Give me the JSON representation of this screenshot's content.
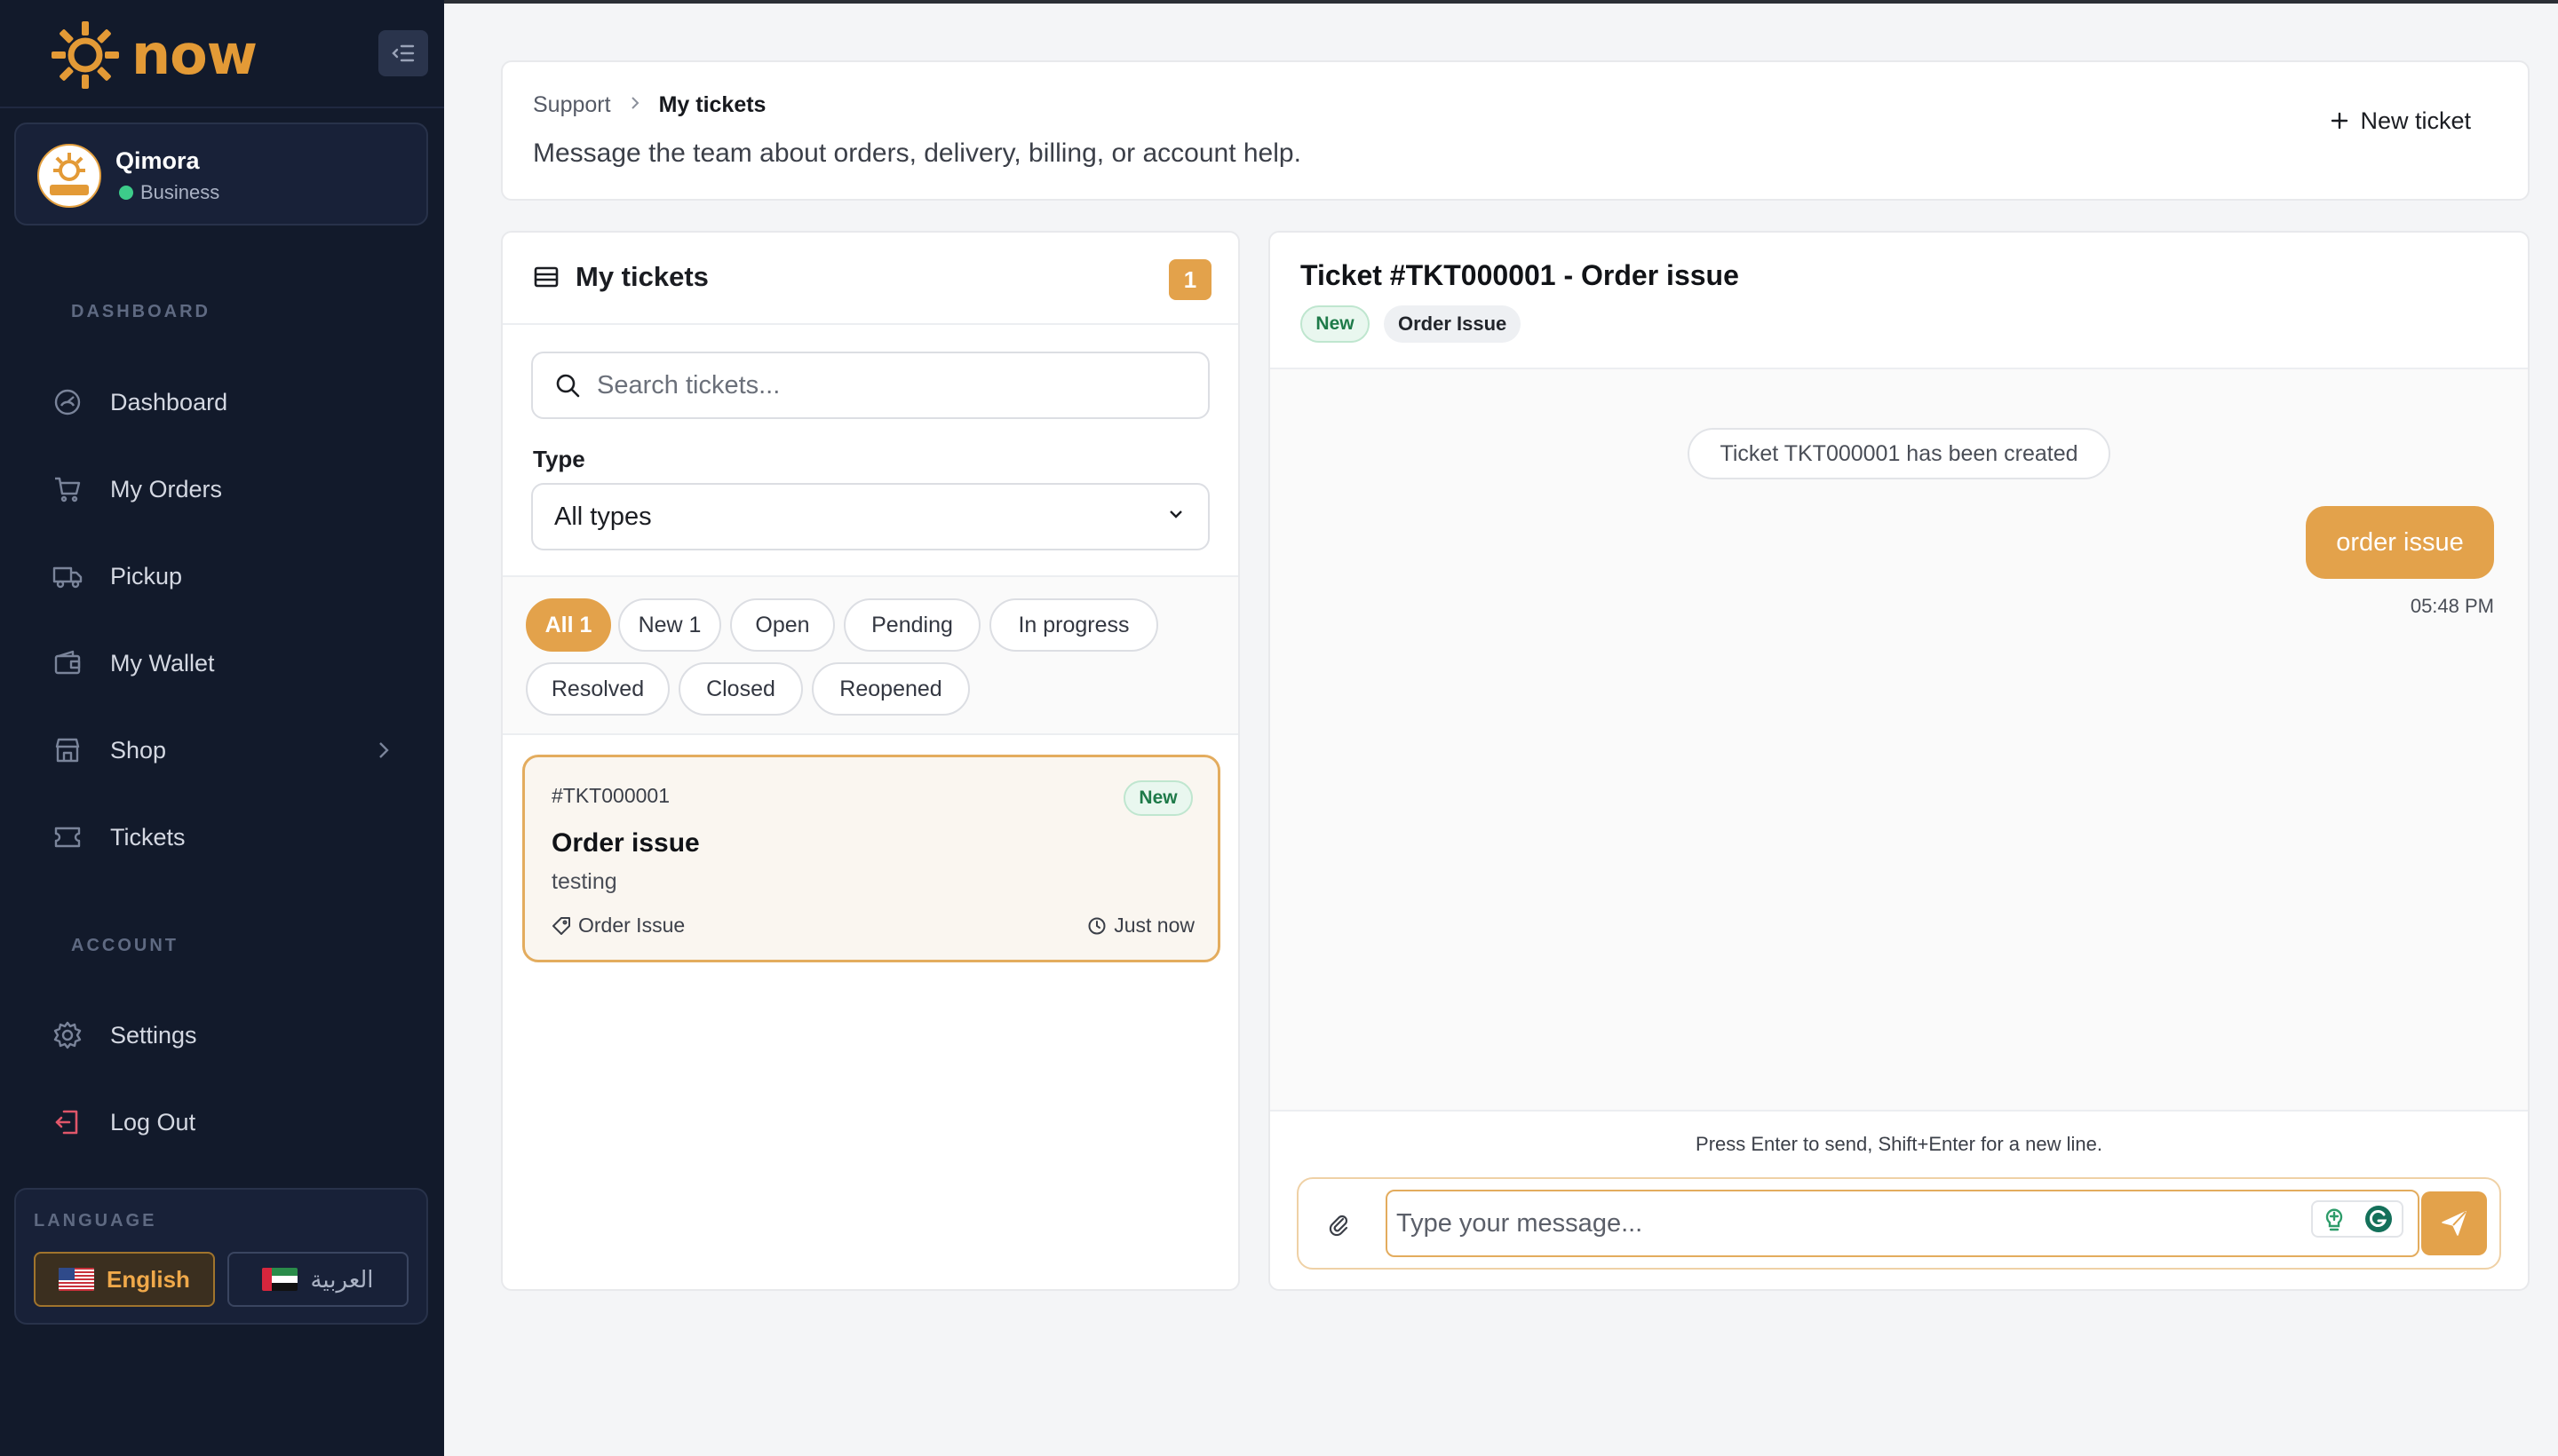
{
  "brand": {
    "name": "now",
    "accent": "#e3a24b"
  },
  "profile": {
    "name": "Qimora",
    "role": "Business"
  },
  "sidebar": {
    "section_dashboard": "DASHBOARD",
    "section_account": "ACCOUNT",
    "items": [
      {
        "label": "Dashboard",
        "icon": "gauge-icon"
      },
      {
        "label": "My Orders",
        "icon": "cart-icon"
      },
      {
        "label": "Pickup",
        "icon": "truck-icon"
      },
      {
        "label": "My Wallet",
        "icon": "wallet-icon"
      },
      {
        "label": "Shop",
        "icon": "store-icon"
      },
      {
        "label": "Tickets",
        "icon": "ticket-icon"
      }
    ],
    "account_items": [
      {
        "label": "Settings",
        "icon": "gear-icon"
      },
      {
        "label": "Log Out",
        "icon": "logout-icon"
      }
    ]
  },
  "language": {
    "label": "LANGUAGE",
    "english": "English",
    "arabic": "العربية"
  },
  "header": {
    "breadcrumb_root": "Support",
    "breadcrumb_current": "My tickets",
    "subtitle": "Message the team about orders, delivery, billing, or account help.",
    "new_ticket": "New ticket"
  },
  "tickets_panel": {
    "title": "My tickets",
    "count": "1",
    "search_placeholder": "Search tickets...",
    "type_label": "Type",
    "type_selected": "All types",
    "filters": [
      "All 1",
      "New 1",
      "Open",
      "Pending",
      "In progress",
      "Resolved",
      "Closed",
      "Reopened"
    ],
    "items": [
      {
        "id": "#TKT000001",
        "status": "New",
        "title": "Order issue",
        "description": "testing",
        "category": "Order Issue",
        "time": "Just now"
      }
    ]
  },
  "chat": {
    "title": "Ticket #TKT000001 - Order issue",
    "status_tag": "New",
    "category_tag": "Order Issue",
    "system_message": "Ticket TKT000001 has been created",
    "message_text": "order issue",
    "message_time": "05:48 PM",
    "hint": "Press Enter to send, Shift+Enter for a new line.",
    "input_placeholder": "Type your message..."
  }
}
